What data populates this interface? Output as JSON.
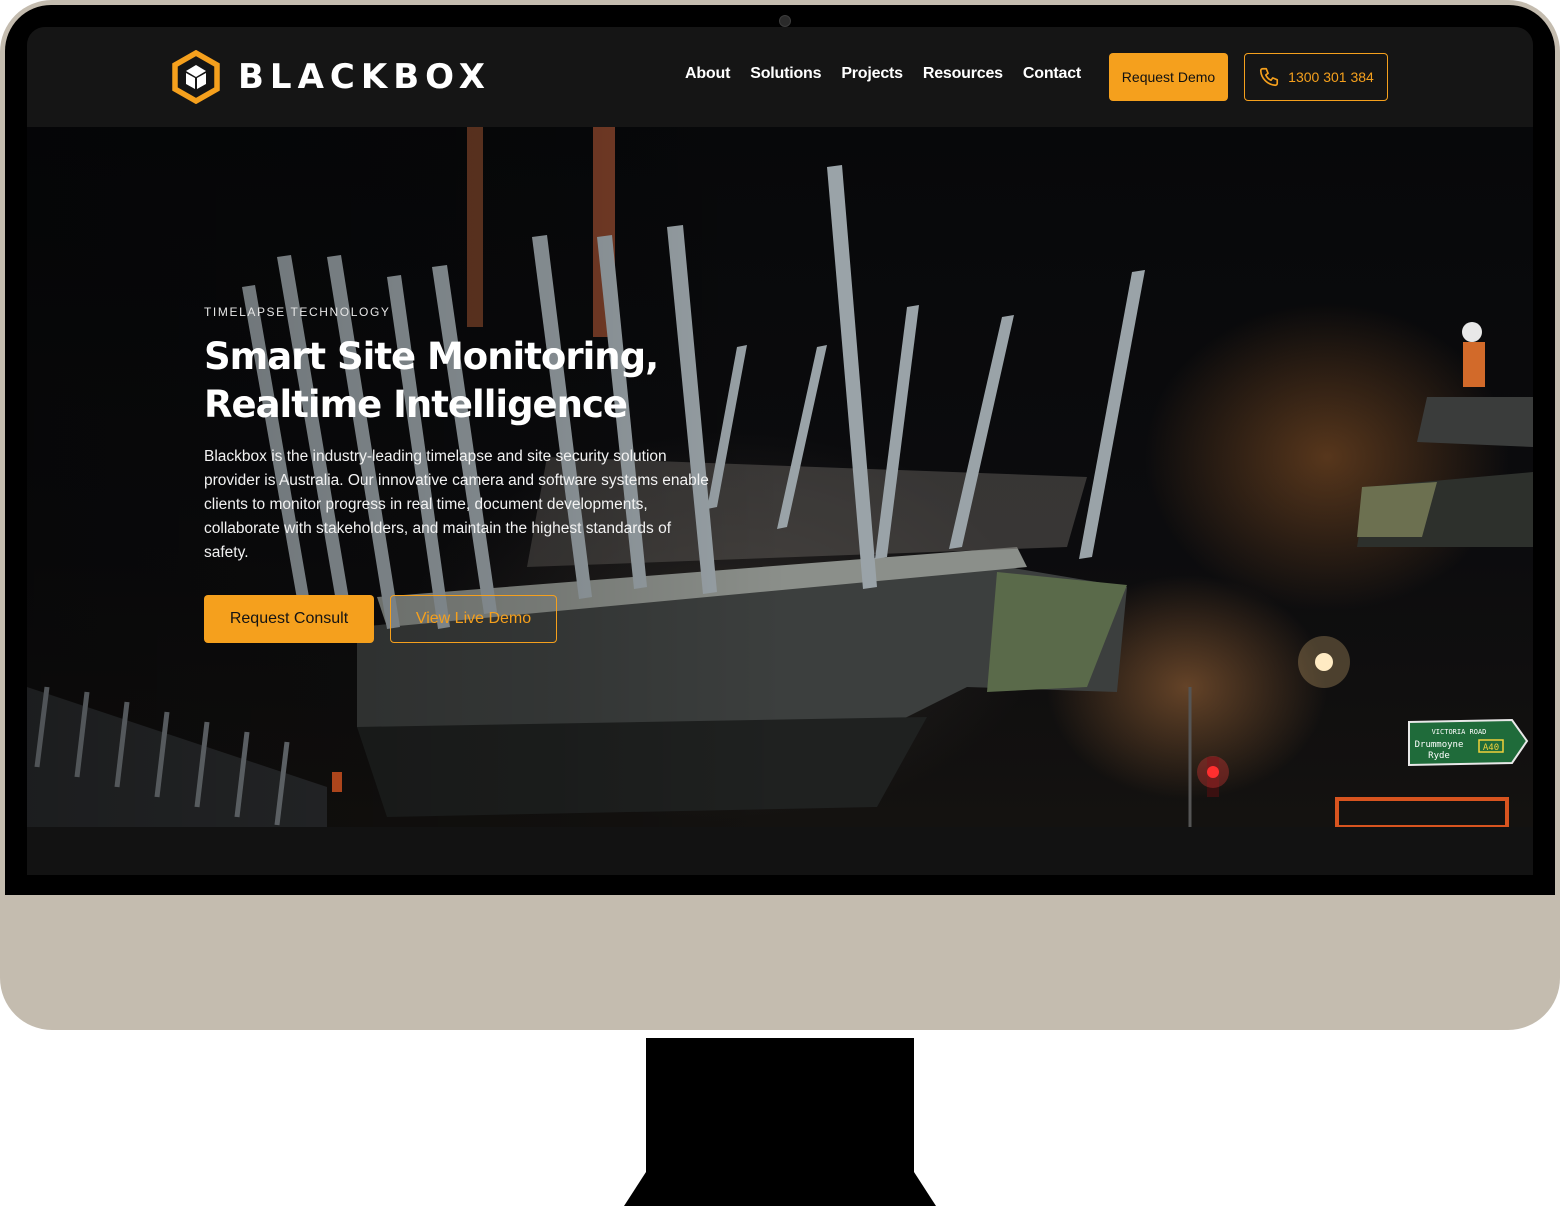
{
  "brand": {
    "name": "BLACKBOX",
    "accent": "#f5a01d",
    "logo_icon": "hexagon-cube-icon"
  },
  "nav": {
    "items": [
      {
        "label": "About"
      },
      {
        "label": "Solutions"
      },
      {
        "label": "Projects"
      },
      {
        "label": "Resources"
      },
      {
        "label": "Contact"
      }
    ],
    "request_demo_label": "Request Demo",
    "phone": {
      "icon": "phone-icon",
      "number": "1300 301 384"
    }
  },
  "hero": {
    "eyebrow": "TIMELAPSE TECHNOLOGY",
    "title": "Smart Site Monitoring, Realtime Intelligence",
    "description": "Blackbox is the industry-leading timelapse and site security solution provider is Australia. Our innovative camera and software systems enable clients to monitor progress in real time, document developments, collaborate with stakeholders, and maintain the highest standards of safety.",
    "primary_cta": "Request Consult",
    "secondary_cta": "View Live Demo",
    "background": {
      "sign_line1": "VICTORIA ROAD",
      "sign_line2": "Drummoyne",
      "sign_line3": "Ryde",
      "sign_route": "A40"
    }
  },
  "colors": {
    "header_bg": "#151515",
    "monitor_body": "#c4bcaf",
    "bezel": "#000000"
  }
}
